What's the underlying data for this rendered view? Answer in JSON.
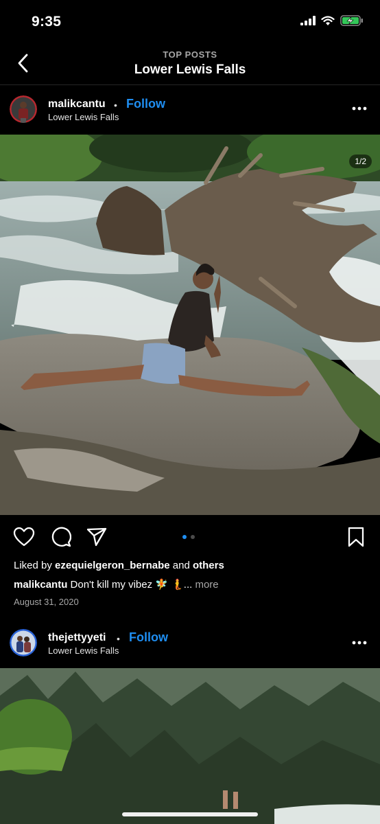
{
  "status_bar": {
    "time": "9:35"
  },
  "header": {
    "subtitle": "TOP POSTS",
    "title": "Lower Lewis Falls"
  },
  "posts": [
    {
      "username": "malikcantu",
      "follow_label": "Follow",
      "location": "Lower Lewis Falls",
      "image_counter": "1/2",
      "liked_prefix": "Liked by ",
      "liked_user": "ezequielgeron_bernabe",
      "liked_mid": " and ",
      "liked_others": "others",
      "caption_user": "malikcantu",
      "caption_text": " Don't kill my vibez 🧚 🧜... ",
      "caption_more": "more",
      "date": "August 31, 2020"
    },
    {
      "username": "thejettyyeti",
      "follow_label": "Follow",
      "location": "Lower Lewis Falls"
    }
  ],
  "colors": {
    "accent": "#1f8ef1",
    "background": "#000000",
    "muted": "#a8a8a8"
  },
  "icons": [
    "back-icon",
    "heart-icon",
    "comment-icon",
    "share-icon",
    "bookmark-icon",
    "more-icon"
  ]
}
